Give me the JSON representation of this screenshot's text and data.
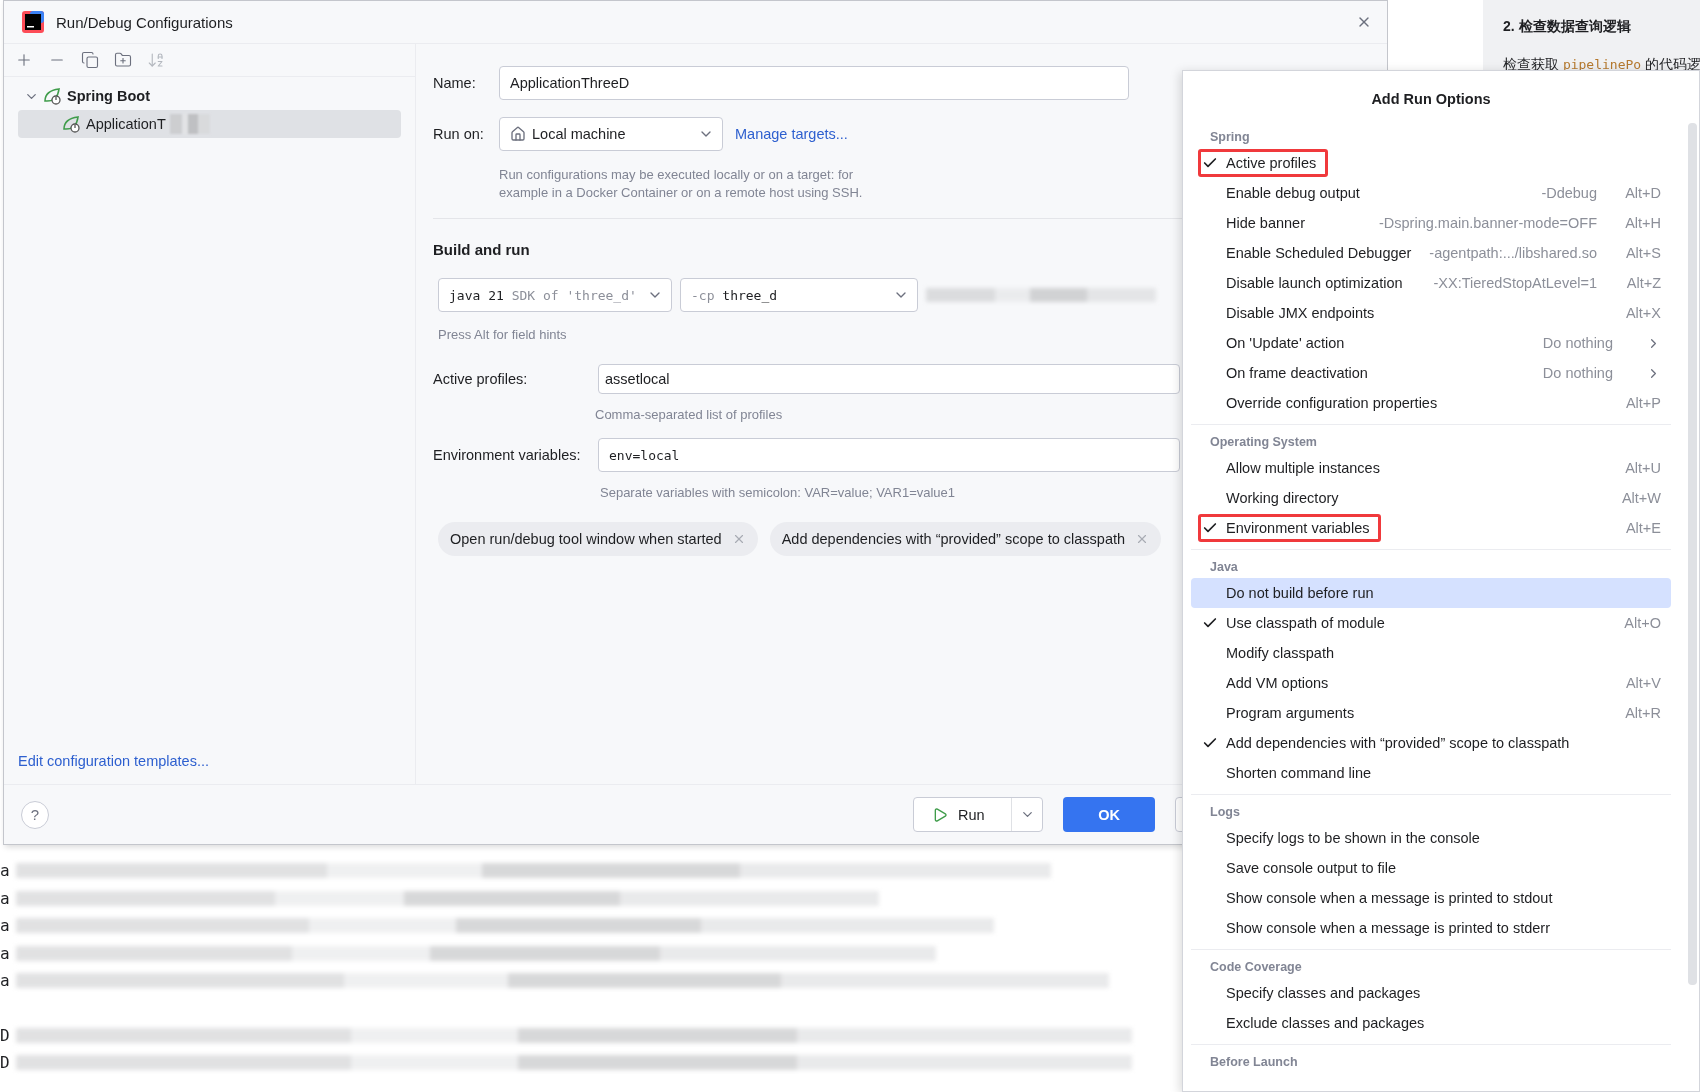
{
  "window": {
    "title": "Run/Debug Configurations"
  },
  "toolbar": [
    {
      "kind": "add",
      "disabled": false
    },
    {
      "kind": "remove",
      "disabled": false
    },
    {
      "kind": "copy",
      "disabled": false
    },
    {
      "kind": "folder",
      "disabled": false
    },
    {
      "kind": "sort",
      "disabled": true
    }
  ],
  "tree": [
    {
      "label": "Spring Boot",
      "expanded": true,
      "selected": false,
      "children": [
        {
          "label": "ApplicationT",
          "selected": true,
          "redacted": true
        }
      ]
    }
  ],
  "templates_link": "Edit configuration templates...",
  "form": {
    "name": {
      "label": "Name:",
      "value": "ApplicationThreeD"
    },
    "run_on": {
      "label": "Run on:",
      "value": "Local machine",
      "link": "Manage targets...",
      "hint": "Run configurations may be executed locally or on a target: for\nexample in a Docker Container or on a remote host using SSH."
    },
    "section": "Build and run",
    "jre": {
      "value": "java 21",
      "detail": "SDK of 'three_d'"
    },
    "classpath": {
      "prefix": "-cp",
      "value": "three_d"
    },
    "field_hint": "Press Alt for field hints",
    "active_profiles": {
      "label": "Active profiles:",
      "value": "assetlocal",
      "hint": "Comma-separated list of profiles"
    },
    "env": {
      "label": "Environment variables:",
      "value": "env=local",
      "hint": "Separate variables with semicolon: VAR=value; VAR1=value1"
    },
    "chips": [
      "Open run/debug tool window when started",
      "Add dependencies with “provided” scope to classpath"
    ]
  },
  "footer": {
    "help": "?",
    "run": "Run",
    "ok": "OK"
  },
  "popup": {
    "title": "Add Run Options",
    "sections": [
      {
        "title": "Spring",
        "items": [
          {
            "label": "Active profiles",
            "checked": true,
            "highlighted": true,
            "selected": false
          },
          {
            "label": "Enable debug output",
            "hint": "-Ddebug",
            "shortcut": "Alt+D",
            "checked": false,
            "highlighted": false,
            "selected": false
          },
          {
            "label": "Hide banner",
            "hint": "-Dspring.main.banner-mode=OFF",
            "shortcut": "Alt+H",
            "checked": false,
            "highlighted": false,
            "selected": false
          },
          {
            "label": "Enable Scheduled Debugger",
            "hint": "-agentpath:.../libshared.so",
            "shortcut": "Alt+S",
            "checked": false,
            "highlighted": false,
            "selected": false
          },
          {
            "label": "Disable launch optimization",
            "hint": "-XX:TieredStopAtLevel=1",
            "shortcut": "Alt+Z",
            "checked": false,
            "highlighted": false,
            "selected": false
          },
          {
            "label": "Disable JMX endpoints",
            "shortcut": "Alt+X",
            "checked": false,
            "highlighted": false,
            "selected": false
          },
          {
            "label": "On 'Update' action",
            "hint": "Do nothing",
            "submenu": true,
            "checked": false,
            "highlighted": false,
            "selected": false
          },
          {
            "label": "On frame deactivation",
            "hint": "Do nothing",
            "submenu": true,
            "checked": false,
            "highlighted": false,
            "selected": false
          },
          {
            "label": "Override configuration properties",
            "shortcut": "Alt+P",
            "checked": false,
            "highlighted": false,
            "selected": false
          }
        ]
      },
      {
        "title": "Operating System",
        "items": [
          {
            "label": "Allow multiple instances",
            "shortcut": "Alt+U",
            "checked": false,
            "highlighted": false,
            "selected": false
          },
          {
            "label": "Working directory",
            "shortcut": "Alt+W",
            "checked": false,
            "highlighted": false,
            "selected": false
          },
          {
            "label": "Environment variables",
            "shortcut": "Alt+E",
            "checked": true,
            "highlighted": true,
            "selected": false
          }
        ]
      },
      {
        "title": "Java",
        "items": [
          {
            "label": "Do not build before run",
            "checked": false,
            "highlighted": false,
            "selected": true
          },
          {
            "label": "Use classpath of module",
            "shortcut": "Alt+O",
            "checked": true,
            "highlighted": false,
            "selected": false
          },
          {
            "label": "Modify classpath",
            "checked": false,
            "highlighted": false,
            "selected": false
          },
          {
            "label": "Add VM options",
            "shortcut": "Alt+V",
            "checked": false,
            "highlighted": false,
            "selected": false
          },
          {
            "label": "Program arguments",
            "shortcut": "Alt+R",
            "checked": false,
            "highlighted": false,
            "selected": false
          },
          {
            "label": "Add dependencies with “provided” scope to classpath",
            "checked": true,
            "highlighted": false,
            "selected": false
          },
          {
            "label": "Shorten command line",
            "checked": false,
            "highlighted": false,
            "selected": false
          }
        ]
      },
      {
        "title": "Logs",
        "items": [
          {
            "label": "Specify logs to be shown in the console",
            "checked": false,
            "highlighted": false,
            "selected": false
          },
          {
            "label": "Save console output to file",
            "checked": false,
            "highlighted": false,
            "selected": false
          },
          {
            "label": "Show console when a message is printed to stdout",
            "checked": false,
            "highlighted": false,
            "selected": false
          },
          {
            "label": "Show console when a message is printed to stderr",
            "checked": false,
            "highlighted": false,
            "selected": false
          }
        ]
      },
      {
        "title": "Code Coverage",
        "items": [
          {
            "label": "Specify classes and packages",
            "checked": false,
            "highlighted": false,
            "selected": false
          },
          {
            "label": "Exclude classes and packages",
            "checked": false,
            "highlighted": false,
            "selected": false
          }
        ]
      },
      {
        "title": "Before Launch"
      }
    ]
  },
  "background_doc": {
    "heading": "2. 检查数据查询逻辑",
    "line": [
      {
        "kind": "text",
        "text": "检查获取 "
      },
      {
        "kind": "code",
        "text": "pipelinePo"
      },
      {
        "kind": "text",
        "text": " 的代码逻"
      }
    ]
  },
  "console": [
    {
      "lines": [
        "a",
        "a",
        "a",
        "a",
        "a"
      ]
    },
    {
      "lines": [
        "D",
        "D"
      ]
    }
  ]
}
